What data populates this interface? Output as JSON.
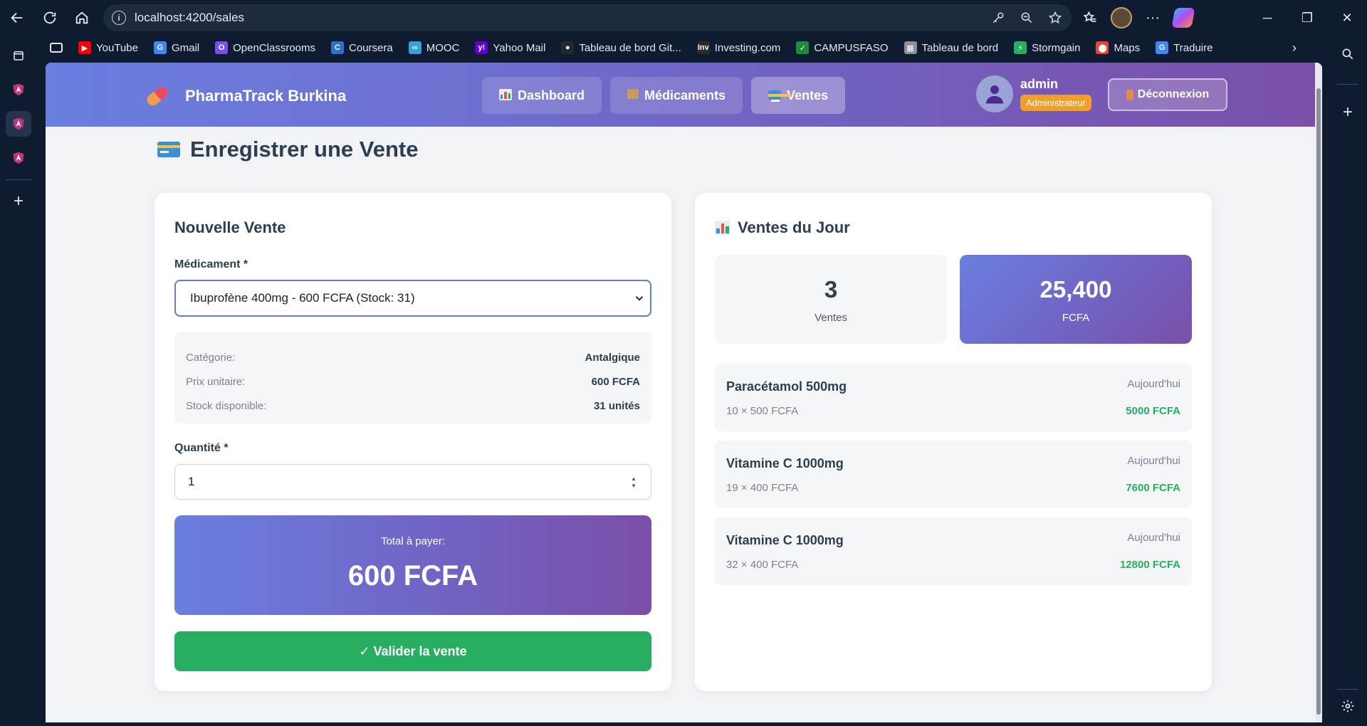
{
  "browser": {
    "url": "localhost:4200/sales",
    "bookmarks": [
      {
        "label": "YouTube",
        "icon": "youtube-icon",
        "color": "#ff0000",
        "glyph": "▶"
      },
      {
        "label": "Gmail",
        "icon": "google-icon",
        "color": "#4285f4",
        "glyph": "G"
      },
      {
        "label": "OpenClassrooms",
        "icon": "openclassrooms-icon",
        "color": "#7451eb",
        "glyph": "O"
      },
      {
        "label": "Coursera",
        "icon": "coursera-icon",
        "color": "#2a73cc",
        "glyph": "C"
      },
      {
        "label": "MOOC",
        "icon": "mooc-icon",
        "color": "#3aa0d8",
        "glyph": "∞"
      },
      {
        "label": "Yahoo Mail",
        "icon": "yahoo-icon",
        "color": "#6001d2",
        "glyph": "y!"
      },
      {
        "label": "Tableau de bord Git...",
        "icon": "github-icon",
        "color": "#24292e",
        "glyph": "●"
      },
      {
        "label": "Investing.com",
        "icon": "investing-icon",
        "color": "#2b2b2b",
        "glyph": "Inv"
      },
      {
        "label": "CAMPUSFASO",
        "icon": "campusfaso-icon",
        "color": "#1f8a3b",
        "glyph": "✓"
      },
      {
        "label": "Tableau de bord",
        "icon": "dashboard-doc-icon",
        "color": "#8a8f9a",
        "glyph": "▦"
      },
      {
        "label": "Stormgain",
        "icon": "stormgain-icon",
        "color": "#27ae60",
        "glyph": "⚡"
      },
      {
        "label": "Maps",
        "icon": "maps-icon",
        "color": "#ea4335",
        "glyph": "⬤"
      },
      {
        "label": "Traduire",
        "icon": "translate-icon",
        "color": "#4285f4",
        "glyph": "G"
      }
    ]
  },
  "header": {
    "app_name": "PharmaTrack Burkina",
    "nav": [
      {
        "label": "Dashboard",
        "icon": "chart-icon",
        "active": false
      },
      {
        "label": "Médicaments",
        "icon": "box-icon",
        "active": false
      },
      {
        "label": "Ventes",
        "icon": "credit-card-icon",
        "active": true
      }
    ],
    "user": {
      "name": "admin",
      "role": "Administrateur"
    },
    "logout_label": "Déconnexion"
  },
  "page": {
    "title": "Enregistrer une Vente"
  },
  "new_sale": {
    "title": "Nouvelle Vente",
    "medicament_label": "Médicament *",
    "medicament_selected": "Ibuprofène 400mg - 600 FCFA (Stock: 31)",
    "info": [
      {
        "key": "Catégorie:",
        "value": "Antalgique"
      },
      {
        "key": "Prix unitaire:",
        "value": "600 FCFA"
      },
      {
        "key": "Stock disponible:",
        "value": "31 unités"
      }
    ],
    "quantity_label": "Quantité *",
    "quantity_value": "1",
    "total_label": "Total à payer:",
    "total_value": "600 FCFA",
    "validate_label": "✓ Valider la vente"
  },
  "today": {
    "title": "Ventes du Jour",
    "count_value": "3",
    "count_label": "Ventes",
    "amount_value": "25,400",
    "amount_label": "FCFA",
    "sales": [
      {
        "name": "Paracétamol 500mg",
        "date": "Aujourd'hui",
        "qty": "10 × 500 FCFA",
        "amount": "5000 FCFA"
      },
      {
        "name": "Vitamine C 1000mg",
        "date": "Aujourd'hui",
        "qty": "19 × 400 FCFA",
        "amount": "7600 FCFA"
      },
      {
        "name": "Vitamine C 1000mg",
        "date": "Aujourd'hui",
        "qty": "32 × 400 FCFA",
        "amount": "12800 FCFA"
      }
    ]
  },
  "colors": {
    "accent_start": "#6a7fe0",
    "accent_end": "#7b4fa8",
    "success": "#27ae60",
    "role_badge": "#f0a02a"
  }
}
